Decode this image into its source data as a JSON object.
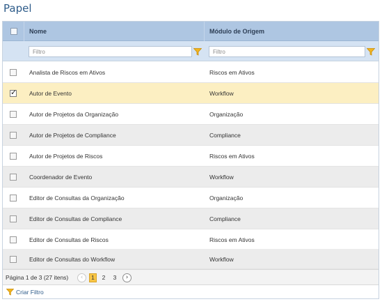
{
  "page": {
    "title": "Papel"
  },
  "grid": {
    "columns": {
      "nome": "Nome",
      "modulo": "Módulo de Origem"
    },
    "filters": {
      "nome_placeholder": "Filtro",
      "modulo_placeholder": "Filtro"
    },
    "rows": [
      {
        "nome": "Analista de Riscos em Ativos",
        "modulo": "Riscos em Ativos",
        "checked": false
      },
      {
        "nome": "Autor de Evento",
        "modulo": "Workflow",
        "checked": true
      },
      {
        "nome": "Autor de Projetos da Organização",
        "modulo": "Organização",
        "checked": false
      },
      {
        "nome": "Autor de Projetos de Compliance",
        "modulo": "Compliance",
        "checked": false
      },
      {
        "nome": "Autor de Projetos de Riscos",
        "modulo": "Riscos em Ativos",
        "checked": false
      },
      {
        "nome": "Coordenador de Evento",
        "modulo": "Workflow",
        "checked": false
      },
      {
        "nome": "Editor de Consultas da Organização",
        "modulo": "Organização",
        "checked": false
      },
      {
        "nome": "Editor de Consultas de Compliance",
        "modulo": "Compliance",
        "checked": false
      },
      {
        "nome": "Editor de Consultas de Riscos",
        "modulo": "Riscos em Ativos",
        "checked": false
      },
      {
        "nome": "Editor de Consultas do Workflow",
        "modulo": "Workflow",
        "checked": false
      }
    ]
  },
  "pager": {
    "info": "Página 1 de 3 (27 itens)",
    "pages": [
      "1",
      "2",
      "3"
    ],
    "current_page": "1",
    "prev_symbol": "‹",
    "next_symbol": "›"
  },
  "footer": {
    "create_filter_label": "Criar Filtro"
  },
  "colors": {
    "title": "#2e5c8a",
    "header_bg": "#aec6e2",
    "filter_bg": "#d5e3f3",
    "selected_row": "#fcefc2",
    "alt_row": "#ececec",
    "filter_icon": "#e8a917",
    "current_page": "#f7c545"
  }
}
